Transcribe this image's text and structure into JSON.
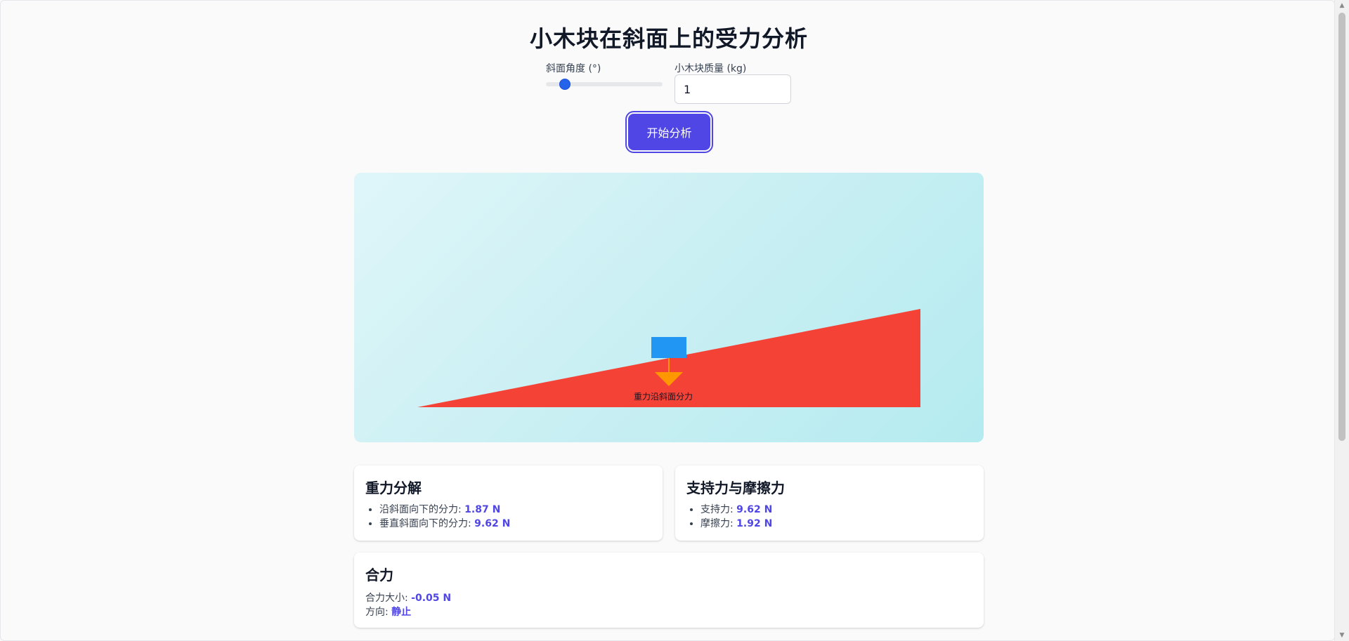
{
  "title": "小木块在斜面上的受力分析",
  "controls": {
    "angle_label": "斜面角度 (°)",
    "angle_value": 11,
    "mass_label": "小木块质量 (kg)",
    "mass_value": "1",
    "start_button": "开始分析"
  },
  "canvas": {
    "force_label": "重力沿斜面分力",
    "colors": {
      "incline": "#f44336",
      "block": "#2196f3",
      "arrow": "#ff9800"
    }
  },
  "gravity_card": {
    "title": "重力分解",
    "items": [
      {
        "label": "沿斜面向下的分力:",
        "value": "1.87 N"
      },
      {
        "label": "垂直斜面向下的分力:",
        "value": "9.62 N"
      }
    ]
  },
  "support_card": {
    "title": "支持力与摩擦力",
    "items": [
      {
        "label": "支持力:",
        "value": "9.62 N"
      },
      {
        "label": "摩擦力:",
        "value": "1.92 N"
      }
    ]
  },
  "net_card": {
    "title": "合力",
    "magnitude_label": "合力大小:",
    "magnitude_value": "-0.05 N",
    "direction_label": "方向:",
    "direction_value": "静止"
  }
}
